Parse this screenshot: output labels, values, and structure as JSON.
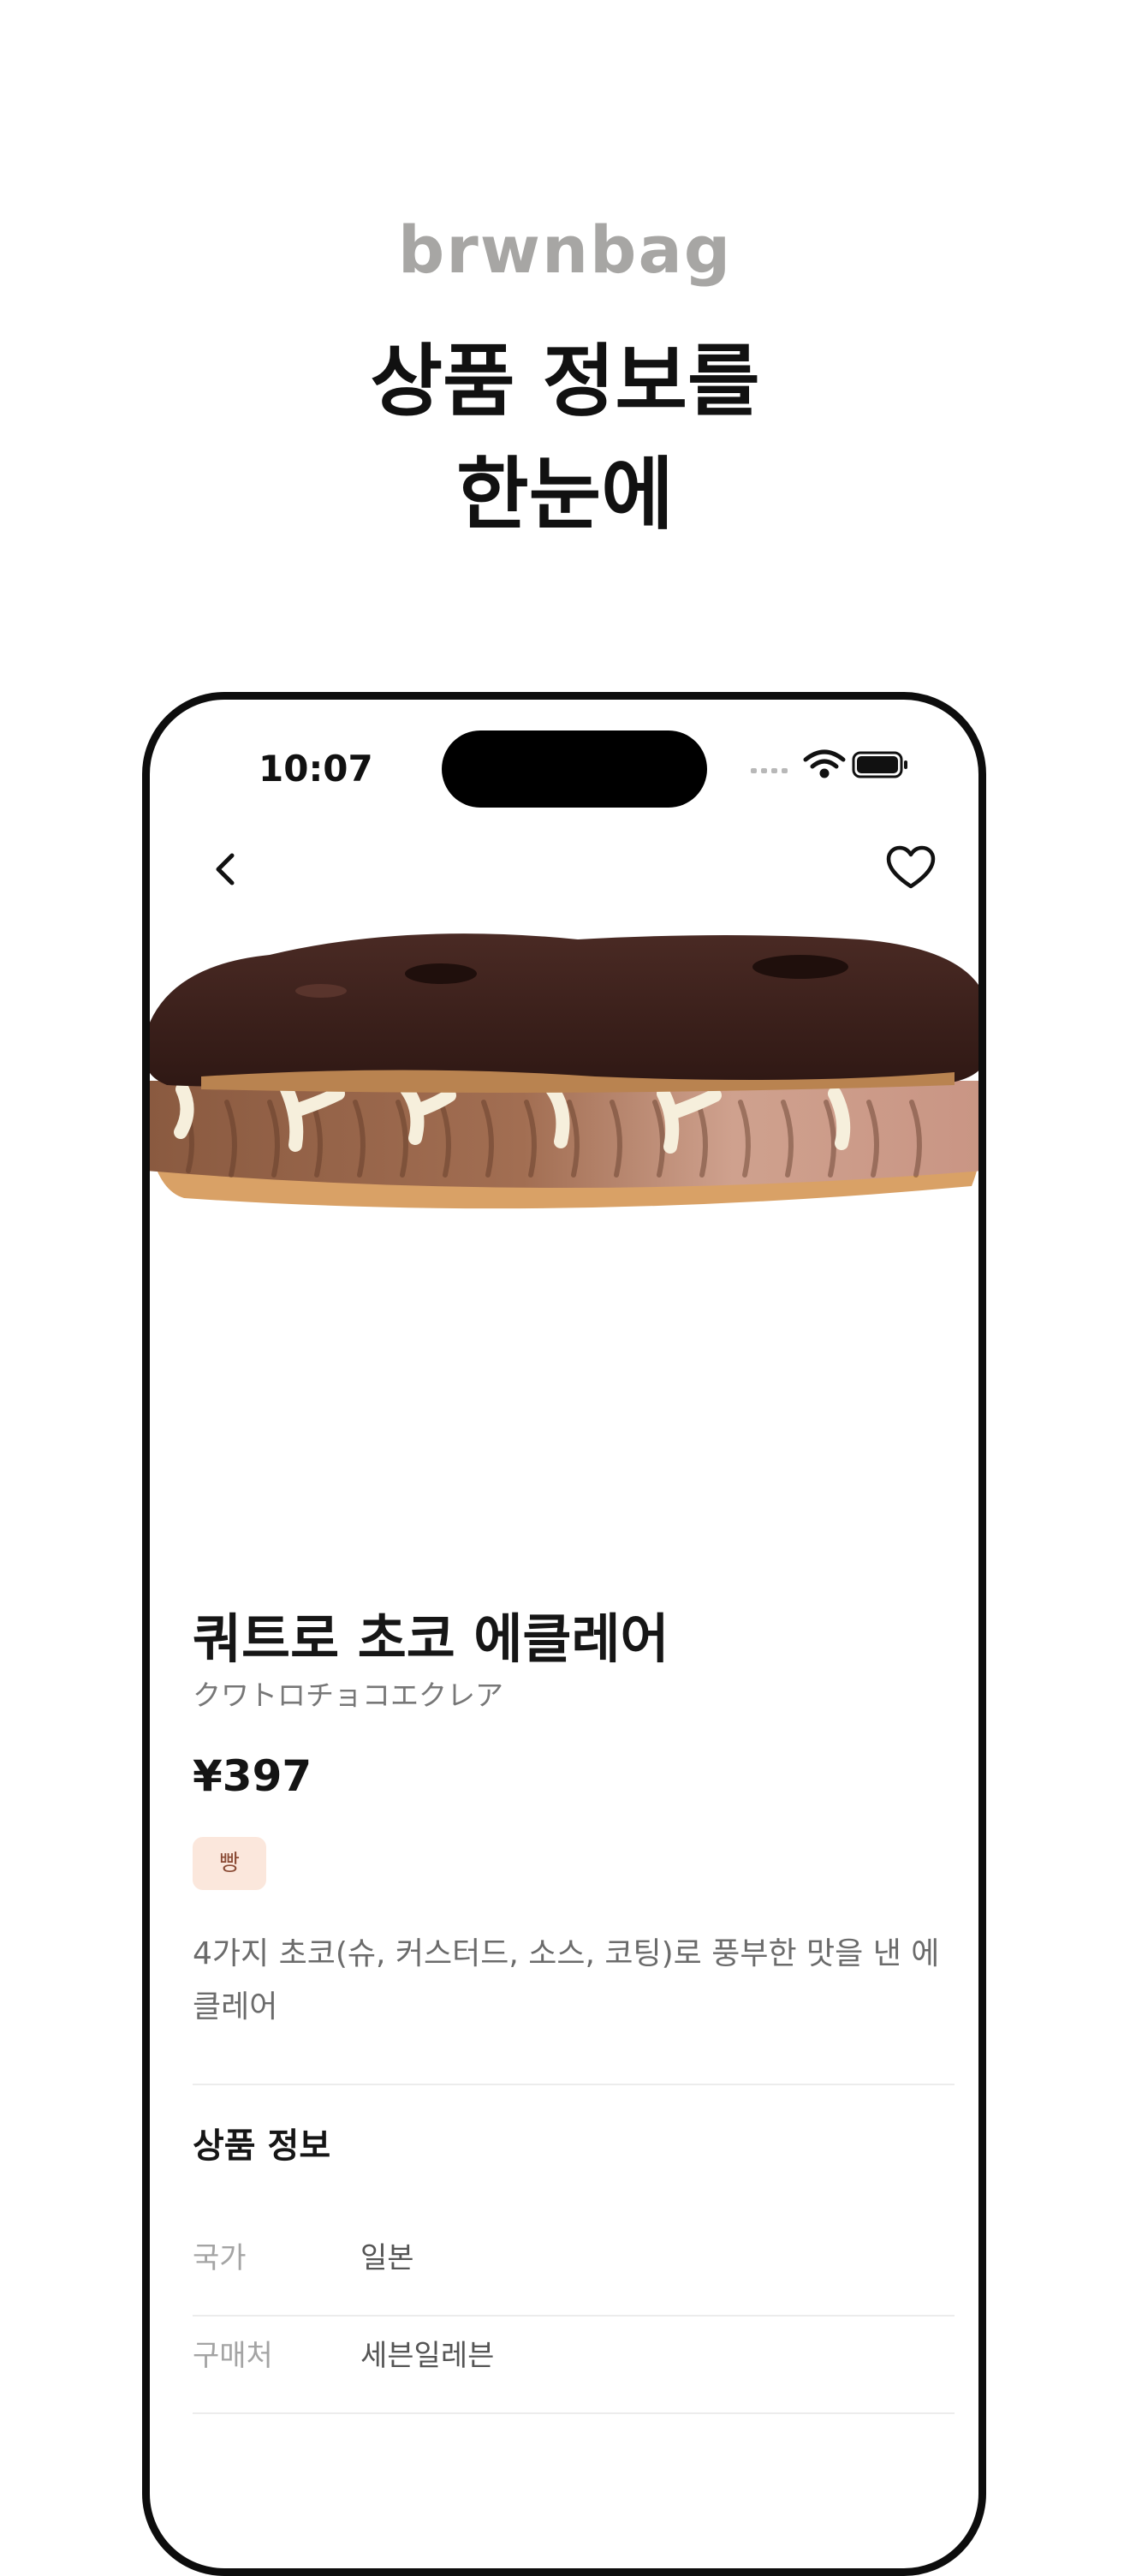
{
  "brand": "brwnbag",
  "headline": {
    "line1": "상품 정보를",
    "line2": "한눈에"
  },
  "status_bar": {
    "time": "10:07"
  },
  "nav": {
    "back_icon": "chevron-left-icon",
    "favorite_icon": "heart-icon"
  },
  "product": {
    "name": "쿼트로 초코 에클레어",
    "subtitle": "クワトロチョコエクレア",
    "price": "¥397",
    "tag": "빵",
    "description": "4가지 초코(슈, 커스터드, 소스, 코팅)로 풍부한 맛을 낸 에클레어"
  },
  "info_section": {
    "title": "상품 정보",
    "rows": [
      {
        "label": "국가",
        "value": "일본"
      },
      {
        "label": "구매처",
        "value": "세븐일레븐"
      }
    ]
  },
  "colors": {
    "brand_gray": "#a7a6a4",
    "tag_bg": "#fbe7dc",
    "tag_text": "#8a4a34",
    "chocolate": "#3a1e18"
  }
}
